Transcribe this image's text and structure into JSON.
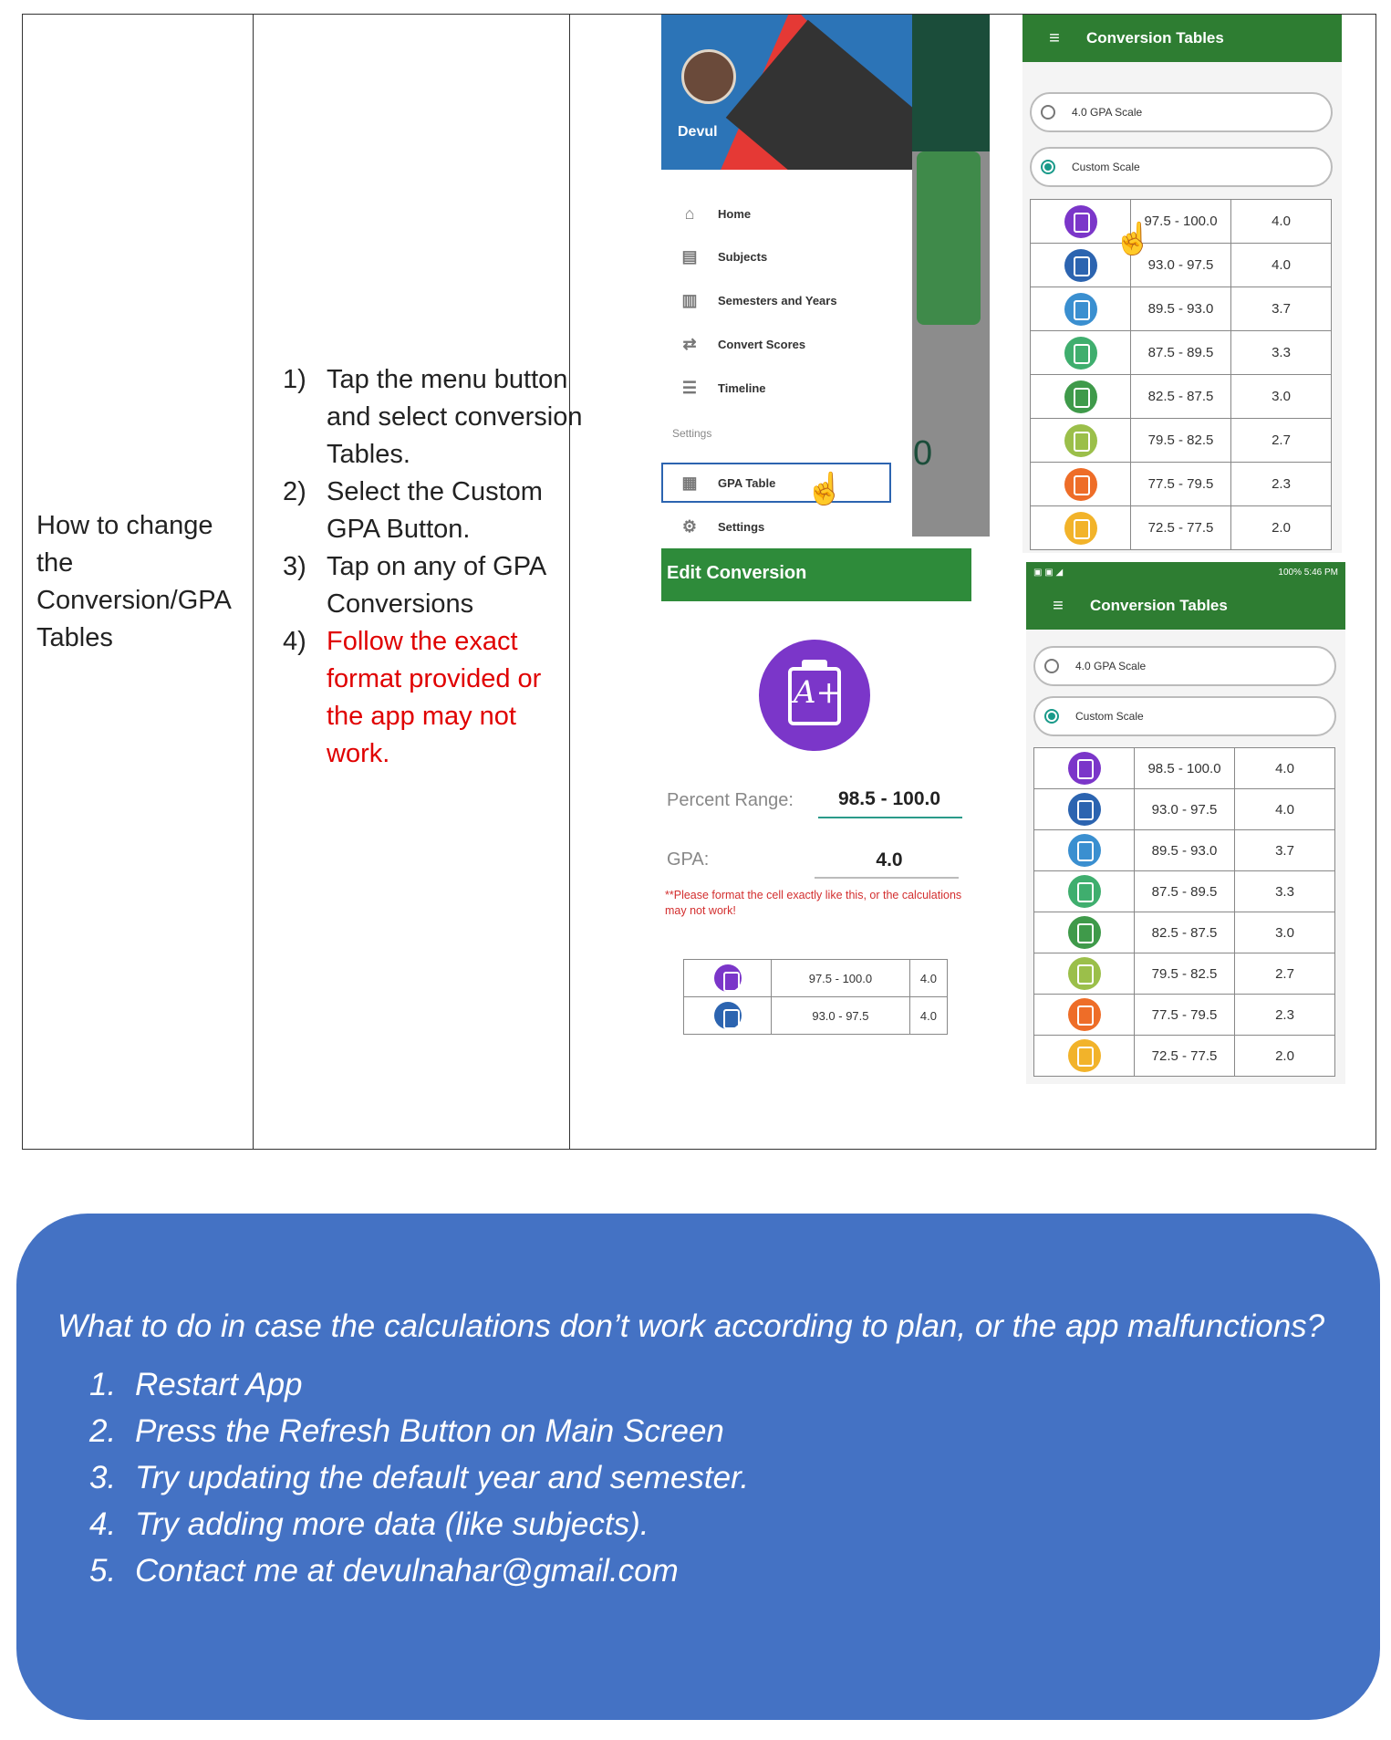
{
  "topic": "How to change the Conversion/GPA Tables",
  "steps": [
    {
      "num": "1)",
      "text": "Tap the menu button and select conversion Tables.",
      "highlight": false
    },
    {
      "num": "2)",
      "text": "Select the Custom GPA Button.",
      "highlight": false
    },
    {
      "num": "3)",
      "text": "Tap on any of GPA Conversions",
      "highlight": false
    },
    {
      "num": "4)",
      "text": "Follow the exact format provided or the app may not work.",
      "highlight": true
    }
  ],
  "drawer": {
    "user_name": "Devul",
    "menu": [
      "Home",
      "Subjects",
      "Semesters and Years",
      "Convert Scores",
      "Timeline"
    ],
    "section": "Settings",
    "settings_menu": [
      "GPA Table",
      "Settings"
    ],
    "bg_number": "0"
  },
  "edit_conversion": {
    "title": "Edit Conversion",
    "icon_text": "A+",
    "percent_label": "Percent Range:",
    "percent_value": "98.5 - 100.0",
    "gpa_label": "GPA:",
    "gpa_value": "4.0",
    "warning": "**Please format the cell exactly like this, or the calculations may not work!",
    "rows": [
      {
        "range": "97.5 - 100.0",
        "gpa": "4.0",
        "color": "#7b36c9"
      },
      {
        "range": "93.0 - 97.5",
        "gpa": "4.0",
        "color": "#2c64b0"
      }
    ]
  },
  "conversion_top": {
    "title": "Conversion Tables",
    "option1": "4.0 GPA Scale",
    "option2": "Custom Scale",
    "rows": [
      {
        "range": "97.5 - 100.0",
        "gpa": "4.0",
        "color": "#7b36c9"
      },
      {
        "range": "93.0 - 97.5",
        "gpa": "4.0",
        "color": "#2c64b0"
      },
      {
        "range": "89.5 - 93.0",
        "gpa": "3.7",
        "color": "#3a8fd0"
      },
      {
        "range": "87.5 - 89.5",
        "gpa": "3.3",
        "color": "#3fae6e"
      },
      {
        "range": "82.5 - 87.5",
        "gpa": "3.0",
        "color": "#3f9a4a"
      },
      {
        "range": "79.5 - 82.5",
        "gpa": "2.7",
        "color": "#9bbf4a"
      },
      {
        "range": "77.5 - 79.5",
        "gpa": "2.3",
        "color": "#ee6d28"
      },
      {
        "range": "72.5 - 77.5",
        "gpa": "2.0",
        "color": "#f2b32a"
      }
    ]
  },
  "conversion_bottom": {
    "status_right": "100% 5:46 PM",
    "title": "Conversion Tables",
    "option1": "4.0 GPA Scale",
    "option2": "Custom Scale",
    "rows": [
      {
        "range": "98.5 - 100.0",
        "gpa": "4.0",
        "color": "#7b36c9"
      },
      {
        "range": "93.0 - 97.5",
        "gpa": "4.0",
        "color": "#2c64b0"
      },
      {
        "range": "89.5 - 93.0",
        "gpa": "3.7",
        "color": "#3a8fd0"
      },
      {
        "range": "87.5 - 89.5",
        "gpa": "3.3",
        "color": "#3fae6e"
      },
      {
        "range": "82.5 - 87.5",
        "gpa": "3.0",
        "color": "#3f9a4a"
      },
      {
        "range": "79.5 - 82.5",
        "gpa": "2.7",
        "color": "#9bbf4a"
      },
      {
        "range": "77.5 - 79.5",
        "gpa": "2.3",
        "color": "#ee6d28"
      },
      {
        "range": "72.5 - 77.5",
        "gpa": "2.0",
        "color": "#f2b32a"
      }
    ]
  },
  "callout": {
    "question": "What to do in case the calculations don’t work according to plan, or the app malfunctions?",
    "items": [
      {
        "num": "1.",
        "text": "Restart App"
      },
      {
        "num": "2.",
        "text": "Press the Refresh Button on Main Screen"
      },
      {
        "num": "3.",
        "text": "Try updating the default year and semester."
      },
      {
        "num": "4.",
        "text": "Try adding more data (like subjects)."
      },
      {
        "num": "5.",
        "text": "Contact me at devulnahar@gmail.com"
      }
    ],
    "color": "#4472c4"
  }
}
